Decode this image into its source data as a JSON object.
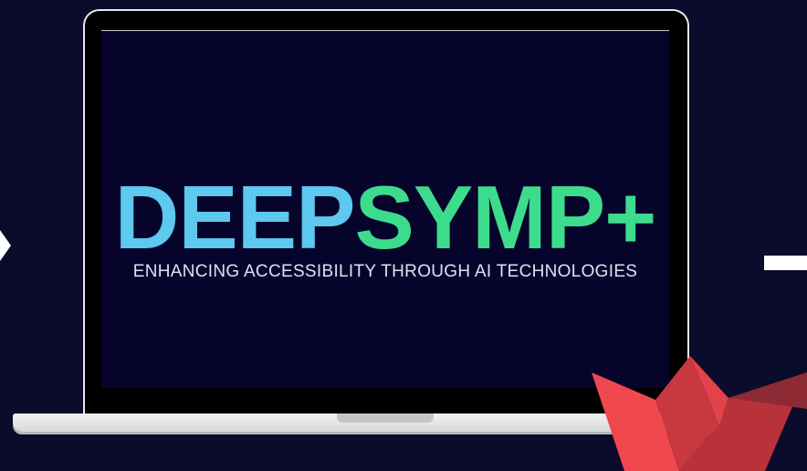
{
  "banner": {
    "logo_part_1": "DEEP",
    "logo_part_2": "SYMP+",
    "tagline": "ENHANCING ACCESSIBILITY THROUGH AI TECHNOLOGIES"
  },
  "colors": {
    "background": "#0b0b2b",
    "screen": "#07042b",
    "logo_part_1": "#5ec8ef",
    "logo_part_2": "#3ddc8c",
    "tagline": "#d8e4f2",
    "accent_red": "#f0484f"
  },
  "icons": {
    "laptop": "laptop-icon",
    "paper_boat": "paper-boat-icon",
    "arrow": "chevron-right-icon",
    "dash": "dash-icon"
  }
}
